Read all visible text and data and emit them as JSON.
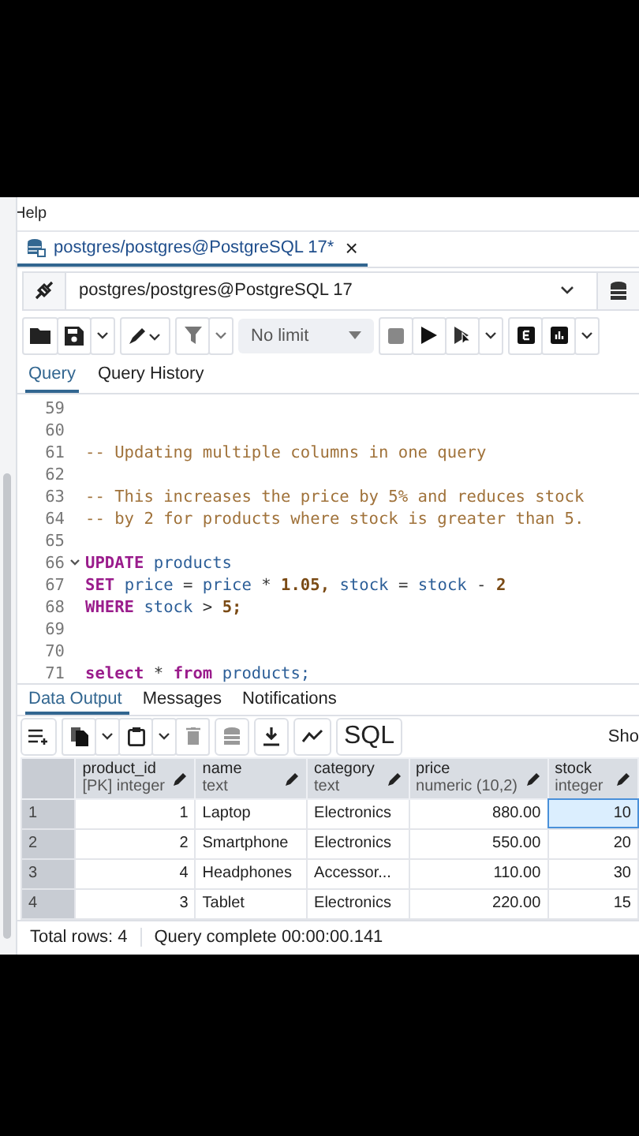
{
  "menu": [
    "Help"
  ],
  "editor_tab": {
    "title": "postgres/postgres@PostgreSQL 17*",
    "close": "×",
    "selected": true
  },
  "connection": {
    "value": "postgres/postgres@PostgreSQL 17"
  },
  "toolbar": {
    "limit": "No limit"
  },
  "query_tabs": [
    {
      "label": "Query",
      "selected": true
    },
    {
      "label": "Query History",
      "selected": false
    }
  ],
  "code_lines": [
    {
      "number": "59"
    },
    {
      "number": "60"
    },
    {
      "number": "61",
      "tokens": [
        {
          "kind": "comment",
          "text": "-- Updating multiple columns in one query"
        }
      ]
    },
    {
      "number": "62"
    },
    {
      "number": "63",
      "tokens": [
        {
          "kind": "comment",
          "text": "-- This increases the price by 5% and reduces stock"
        }
      ]
    },
    {
      "number": "64",
      "tokens": [
        {
          "kind": "comment",
          "text": "-- by 2 for products where stock is greater than 5."
        }
      ]
    },
    {
      "number": "65"
    },
    {
      "number": "66",
      "fold": true,
      "tokens": [
        {
          "kind": "keyword",
          "text": "UPDATE"
        },
        {
          "kind": "ident",
          "text": "products"
        }
      ]
    },
    {
      "number": "67",
      "tokens": [
        {
          "kind": "keyword",
          "text": "SET"
        },
        {
          "kind": "ident",
          "text": "price"
        },
        {
          "kind": "op",
          "text": "="
        },
        {
          "kind": "ident",
          "text": "price"
        },
        {
          "kind": "op",
          "text": "*"
        },
        {
          "kind": "number",
          "text": "1.05,"
        },
        {
          "kind": "ident",
          "text": "stock"
        },
        {
          "kind": "op",
          "text": "="
        },
        {
          "kind": "ident",
          "text": "stock"
        },
        {
          "kind": "op",
          "text": "-"
        },
        {
          "kind": "number",
          "text": "2"
        }
      ]
    },
    {
      "number": "68",
      "tokens": [
        {
          "kind": "keyword",
          "text": "WHERE"
        },
        {
          "kind": "ident",
          "text": "stock"
        },
        {
          "kind": "op",
          "text": ">"
        },
        {
          "kind": "number",
          "text": "5;"
        }
      ]
    },
    {
      "number": "69"
    },
    {
      "number": "70"
    },
    {
      "number": "71",
      "tokens": [
        {
          "kind": "keyword",
          "text": "select"
        },
        {
          "kind": "op",
          "text": "*"
        },
        {
          "kind": "keyword",
          "text": "from"
        },
        {
          "kind": "ident",
          "text": "products;"
        }
      ]
    }
  ],
  "result_tabs": [
    {
      "label": "Data Output",
      "selected": true
    },
    {
      "label": "Messages",
      "selected": false
    },
    {
      "label": "Notifications",
      "selected": false
    }
  ],
  "result_toolbar": {
    "sql": "SQL",
    "show": "Sho"
  },
  "table": {
    "columns": [
      {
        "name": "product_id",
        "type": "[PK] integer"
      },
      {
        "name": "name",
        "type": "text"
      },
      {
        "name": "category",
        "type": "text"
      },
      {
        "name": "price",
        "type": "numeric (10,2)"
      },
      {
        "name": "stock",
        "type": "integer"
      }
    ],
    "rows": [
      {
        "index": "1",
        "cells": [
          {
            "text": "1",
            "selected": false
          },
          {
            "text": "Laptop",
            "selected": false
          },
          {
            "text": "Electronics",
            "selected": false
          },
          {
            "text": "880.00",
            "selected": false
          },
          {
            "text": "10",
            "selected": true
          }
        ]
      },
      {
        "index": "2",
        "cells": [
          {
            "text": "2",
            "selected": false
          },
          {
            "text": "Smartphone",
            "selected": false
          },
          {
            "text": "Electronics",
            "selected": false
          },
          {
            "text": "550.00",
            "selected": false
          },
          {
            "text": "20",
            "selected": false
          }
        ]
      },
      {
        "index": "3",
        "cells": [
          {
            "text": "4",
            "selected": false
          },
          {
            "text": "Headphones",
            "selected": false
          },
          {
            "text": "Accessor...",
            "selected": false
          },
          {
            "text": "110.00",
            "selected": false
          },
          {
            "text": "30",
            "selected": false
          }
        ]
      },
      {
        "index": "4",
        "cells": [
          {
            "text": "3",
            "selected": false
          },
          {
            "text": "Tablet",
            "selected": false
          },
          {
            "text": "Electronics",
            "selected": false
          },
          {
            "text": "220.00",
            "selected": false
          },
          {
            "text": "15",
            "selected": false
          }
        ]
      }
    ]
  },
  "status_bar": {
    "rows": "Total rows: 4",
    "message": "Query complete 00:00:00.141"
  }
}
